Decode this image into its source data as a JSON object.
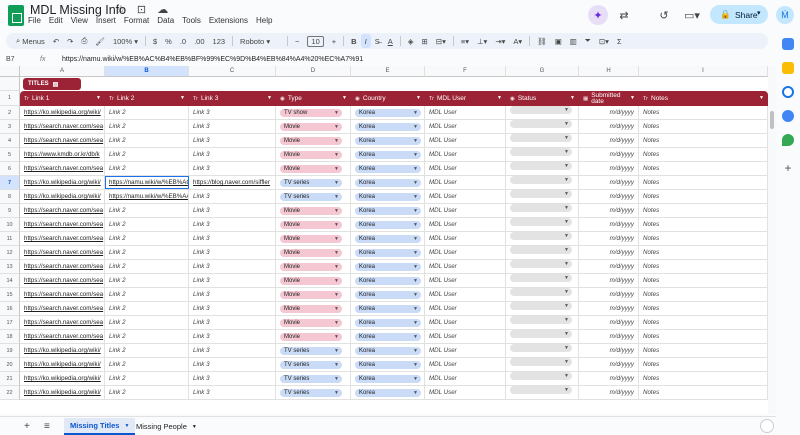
{
  "doc": {
    "title": "MDL Missing Info",
    "title_icons": "☆ ⊡ ☁"
  },
  "menu": [
    "File",
    "Edit",
    "View",
    "Insert",
    "Format",
    "Data",
    "Tools",
    "Extensions",
    "Help"
  ],
  "topright": {
    "share_label": "Share",
    "avatar_letter": "Ṁ"
  },
  "toolbar": {
    "menus_label": "Menus",
    "zoom": "100%",
    "currency": "$",
    "percent": "%",
    "dec_less": ".0",
    "dec_more": ".00",
    "number_format": "123",
    "font": "Roboto",
    "font_size": "10",
    "bold": "B",
    "italic": "I",
    "strike": "S̶",
    "text_color": "A",
    "functions": "Σ"
  },
  "formula_bar": {
    "cell_ref": "B7",
    "fx": "fx",
    "content": "https://namu.wiki/w/%EB%AC%B4%EB%BF%99%EC%9D%B4%EB%84%A4%20%EC%A7%91"
  },
  "columns": [
    "A",
    "B",
    "C",
    "D",
    "E",
    "F",
    "G",
    "H",
    "I"
  ],
  "table_name": "TITLES",
  "headers": [
    {
      "icon": "Tr",
      "label": "Link 1"
    },
    {
      "icon": "Tr",
      "label": "Link 2"
    },
    {
      "icon": "Tr",
      "label": "Link 3"
    },
    {
      "icon": "◉",
      "label": "Type"
    },
    {
      "icon": "◉",
      "label": "Country"
    },
    {
      "icon": "Tr",
      "label": "MDL User"
    },
    {
      "icon": "◉",
      "label": "Status"
    },
    {
      "icon": "▦",
      "label": "Submitted date"
    },
    {
      "icon": "Tr",
      "label": "Notes"
    }
  ],
  "rows": [
    {
      "n": "2",
      "l1": "https://ko.wikipedia.org/wiki/",
      "l2": "Link 2",
      "l3": "Link 3",
      "type": "TV show",
      "tclass": "tvshow",
      "country": "Korea",
      "user": "MDL User",
      "date": "m/d/yyyy",
      "notes": "Notes"
    },
    {
      "n": "3",
      "l1": "https://search.naver.com/sea",
      "l2": "Link 2",
      "l3": "Link 3",
      "type": "Movie",
      "tclass": "movie",
      "country": "Korea",
      "user": "MDL User",
      "date": "m/d/yyyy",
      "notes": "Notes"
    },
    {
      "n": "4",
      "l1": "https://search.naver.com/sea",
      "l2": "Link 2",
      "l3": "Link 3",
      "type": "Movie",
      "tclass": "movie",
      "country": "Korea",
      "user": "MDL User",
      "date": "m/d/yyyy",
      "notes": "Notes"
    },
    {
      "n": "5",
      "l1": "https://www.kmdb.or.kr/db/k",
      "l2": "Link 2",
      "l3": "Link 3",
      "type": "Movie",
      "tclass": "movie",
      "country": "Korea",
      "user": "MDL User",
      "date": "m/d/yyyy",
      "notes": "Notes"
    },
    {
      "n": "6",
      "l1": "https://search.naver.com/sea",
      "l2": "Link 2",
      "l3": "Link 3",
      "type": "Movie",
      "tclass": "movie",
      "country": "Korea",
      "user": "MDL User",
      "date": "m/d/yyyy",
      "notes": "Notes"
    },
    {
      "n": "7",
      "l1": "https://ko.wikipedia.org/wiki/",
      "l2": "https://namu.wiki/w/%EB%AC",
      "l3": "https://blog.naver.com/siffler",
      "type": "TV series",
      "tclass": "tvseries",
      "country": "Korea",
      "user": "MDL User",
      "date": "m/d/yyyy",
      "notes": "Notes"
    },
    {
      "n": "8",
      "l1": "https://ko.wikipedia.org/wiki/",
      "l2": "https://namu.wiki/w/%EB%AA",
      "l3": "Link 3",
      "type": "TV series",
      "tclass": "tvseries",
      "country": "Korea",
      "user": "MDL User",
      "date": "m/d/yyyy",
      "notes": "Notes"
    },
    {
      "n": "9",
      "l1": "https://search.naver.com/sea",
      "l2": "Link 2",
      "l3": "Link 3",
      "type": "Movie",
      "tclass": "movie",
      "country": "Korea",
      "user": "MDL User",
      "date": "m/d/yyyy",
      "notes": "Notes"
    },
    {
      "n": "10",
      "l1": "https://search.naver.com/sea",
      "l2": "Link 2",
      "l3": "Link 3",
      "type": "Movie",
      "tclass": "movie",
      "country": "Korea",
      "user": "MDL User",
      "date": "m/d/yyyy",
      "notes": "Notes"
    },
    {
      "n": "11",
      "l1": "https://search.naver.com/sea",
      "l2": "Link 2",
      "l3": "Link 3",
      "type": "Movie",
      "tclass": "movie",
      "country": "Korea",
      "user": "MDL User",
      "date": "m/d/yyyy",
      "notes": "Notes"
    },
    {
      "n": "12",
      "l1": "https://search.naver.com/sea",
      "l2": "Link 2",
      "l3": "Link 3",
      "type": "Movie",
      "tclass": "movie",
      "country": "Korea",
      "user": "MDL User",
      "date": "m/d/yyyy",
      "notes": "Notes"
    },
    {
      "n": "13",
      "l1": "https://search.naver.com/sea",
      "l2": "Link 2",
      "l3": "Link 3",
      "type": "Movie",
      "tclass": "movie",
      "country": "Korea",
      "user": "MDL User",
      "date": "m/d/yyyy",
      "notes": "Notes"
    },
    {
      "n": "14",
      "l1": "https://search.naver.com/sea",
      "l2": "Link 2",
      "l3": "Link 3",
      "type": "Movie",
      "tclass": "movie",
      "country": "Korea",
      "user": "MDL User",
      "date": "m/d/yyyy",
      "notes": "Notes"
    },
    {
      "n": "15",
      "l1": "https://search.naver.com/sea",
      "l2": "Link 2",
      "l3": "Link 3",
      "type": "Movie",
      "tclass": "movie",
      "country": "Korea",
      "user": "MDL User",
      "date": "m/d/yyyy",
      "notes": "Notes"
    },
    {
      "n": "16",
      "l1": "https://search.naver.com/sea",
      "l2": "Link 2",
      "l3": "Link 3",
      "type": "Movie",
      "tclass": "movie",
      "country": "Korea",
      "user": "MDL User",
      "date": "m/d/yyyy",
      "notes": "Notes"
    },
    {
      "n": "17",
      "l1": "https://search.naver.com/sea",
      "l2": "Link 2",
      "l3": "Link 3",
      "type": "Movie",
      "tclass": "movie",
      "country": "Korea",
      "user": "MDL User",
      "date": "m/d/yyyy",
      "notes": "Notes"
    },
    {
      "n": "18",
      "l1": "https://search.naver.com/sea",
      "l2": "Link 2",
      "l3": "Link 3",
      "type": "Movie",
      "tclass": "movie",
      "country": "Korea",
      "user": "MDL User",
      "date": "m/d/yyyy",
      "notes": "Notes"
    },
    {
      "n": "19",
      "l1": "https://ko.wikipedia.org/wiki/",
      "l2": "Link 2",
      "l3": "Link 3",
      "type": "TV series",
      "tclass": "tvseries",
      "country": "Korea",
      "user": "MDL User",
      "date": "m/d/yyyy",
      "notes": "Notes"
    },
    {
      "n": "20",
      "l1": "https://ko.wikipedia.org/wiki/",
      "l2": "Link 2",
      "l3": "Link 3",
      "type": "TV series",
      "tclass": "tvseries",
      "country": "Korea",
      "user": "MDL User",
      "date": "m/d/yyyy",
      "notes": "Notes"
    },
    {
      "n": "21",
      "l1": "https://ko.wikipedia.org/wiki/",
      "l2": "Link 2",
      "l3": "Link 3",
      "type": "TV series",
      "tclass": "tvseries",
      "country": "Korea",
      "user": "MDL User",
      "date": "m/d/yyyy",
      "notes": "Notes"
    },
    {
      "n": "22",
      "l1": "https://ko.wikipedia.org/wiki/",
      "l2": "Link 2",
      "l3": "Link 3",
      "type": "TV series",
      "tclass": "tvseries",
      "country": "Korea",
      "user": "MDL User",
      "date": "m/d/yyyy",
      "notes": "Notes"
    }
  ],
  "selected_cell": "B7",
  "sheets": [
    {
      "label": "Missing Titles",
      "active": true
    },
    {
      "label": "Missing People",
      "active": false
    }
  ],
  "colors": {
    "table_header": "#9b2335",
    "movie_chip": "#f4c7d2",
    "tvseries_chip": "#c9dbf7",
    "korea_chip": "#c9dbf7",
    "status_chip": "#e3e3e3",
    "accent": "#0b57d0"
  }
}
